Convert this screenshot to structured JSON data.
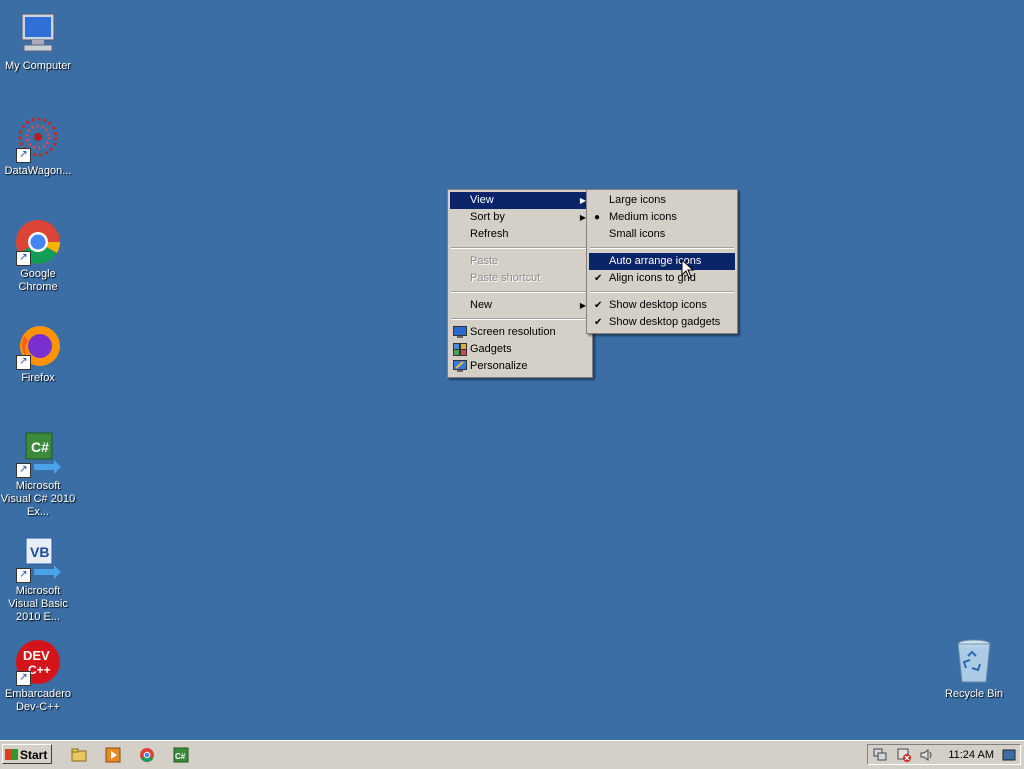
{
  "desktop_icons": [
    {
      "label": "My Computer",
      "icon": "computer-icon",
      "shortcut": false
    },
    {
      "label": "DataWagon...",
      "icon": "datawagon-icon",
      "shortcut": true
    },
    {
      "label": "Google Chrome",
      "icon": "chrome-icon",
      "shortcut": true
    },
    {
      "label": "Firefox",
      "icon": "firefox-icon",
      "shortcut": true
    },
    {
      "label": "Microsoft Visual C# 2010 Ex...",
      "icon": "visual-csharp-icon",
      "shortcut": true
    },
    {
      "label": "Microsoft Visual Basic 2010 E...",
      "icon": "visual-basic-icon",
      "shortcut": true
    },
    {
      "label": "Embarcadero Dev-C++",
      "icon": "devcpp-icon",
      "shortcut": true
    },
    {
      "label": "Recycle Bin",
      "icon": "recycle-bin-icon",
      "shortcut": false
    }
  ],
  "context_menu": {
    "view": "View",
    "sort_by": "Sort by",
    "refresh": "Refresh",
    "paste": "Paste",
    "paste_shortcut": "Paste shortcut",
    "new": "New",
    "screen_resolution": "Screen resolution",
    "gadgets": "Gadgets",
    "personalize": "Personalize"
  },
  "view_submenu": {
    "large_icons": "Large icons",
    "medium_icons": "Medium icons",
    "small_icons": "Small icons",
    "auto_arrange": "Auto arrange icons",
    "align_to_grid": "Align icons to grid",
    "show_desktop_icons": "Show desktop icons",
    "show_gadgets": "Show desktop gadgets"
  },
  "taskbar": {
    "start_label": "Start",
    "clock": "11:24 AM"
  },
  "colors": {
    "desktop": "#3a6ea5",
    "menu_highlight": "#0a246a",
    "menu_bg": "#d4d0c8"
  }
}
